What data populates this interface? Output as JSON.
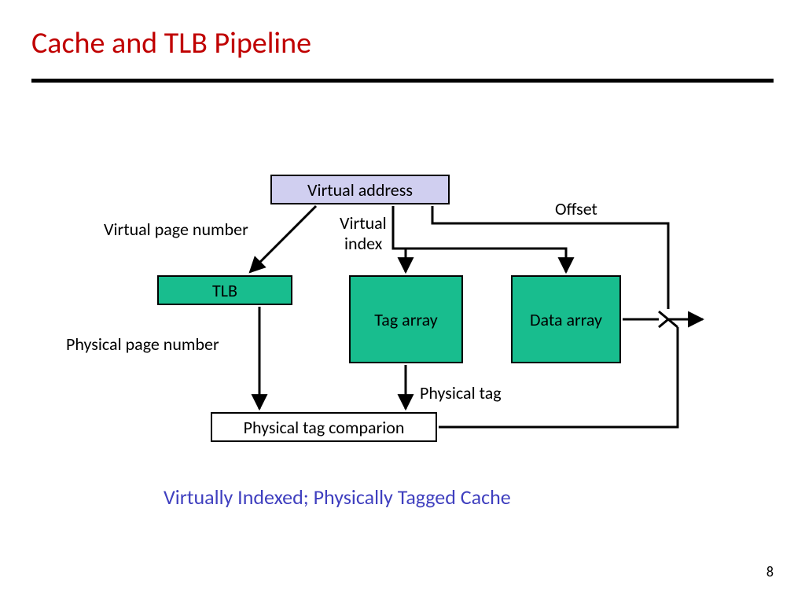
{
  "title": "Cache and TLB Pipeline",
  "boxes": {
    "virtual_address": "Virtual address",
    "tlb": "TLB",
    "tag_array": "Tag array",
    "data_array": "Data array",
    "phys_tag_cmp": "Physical tag comparion"
  },
  "labels": {
    "vpn": "Virtual page number",
    "vindex_l1": "Virtual",
    "vindex_l2": "index",
    "offset": "Offset",
    "ppn": "Physical page number",
    "ptag": "Physical tag"
  },
  "footer": "Virtually Indexed; Physically Tagged Cache",
  "page": "8"
}
